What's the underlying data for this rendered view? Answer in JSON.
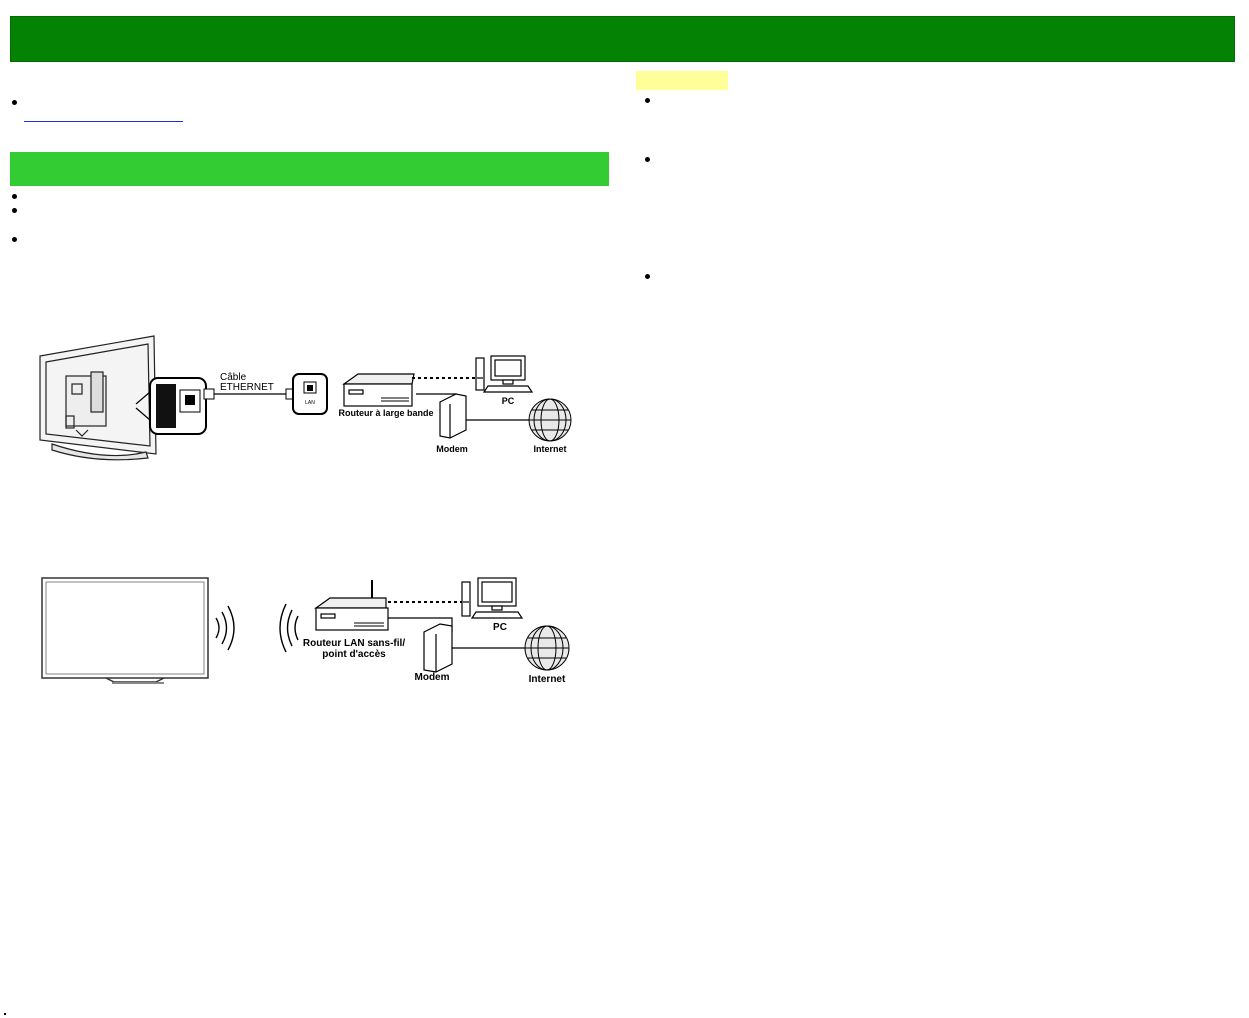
{
  "wired_diagram": {
    "cable_label_line1": "Câble",
    "cable_label_line2": "ETHERNET",
    "lan_label": "LAN",
    "router_label": "Routeur à large bande",
    "pc_label": "PC",
    "modem_label": "Modem",
    "internet_label": "Internet"
  },
  "wireless_diagram": {
    "router_label_line1": "Routeur LAN sans-fil/",
    "router_label_line2": "point d'accès",
    "pc_label": "PC",
    "modem_label": "Modem",
    "internet_label": "Internet"
  },
  "colors": {
    "title_bar": "#048204",
    "section_bar": "#33cc33",
    "note_highlight": "#ffff99",
    "link": "#2233cc"
  }
}
